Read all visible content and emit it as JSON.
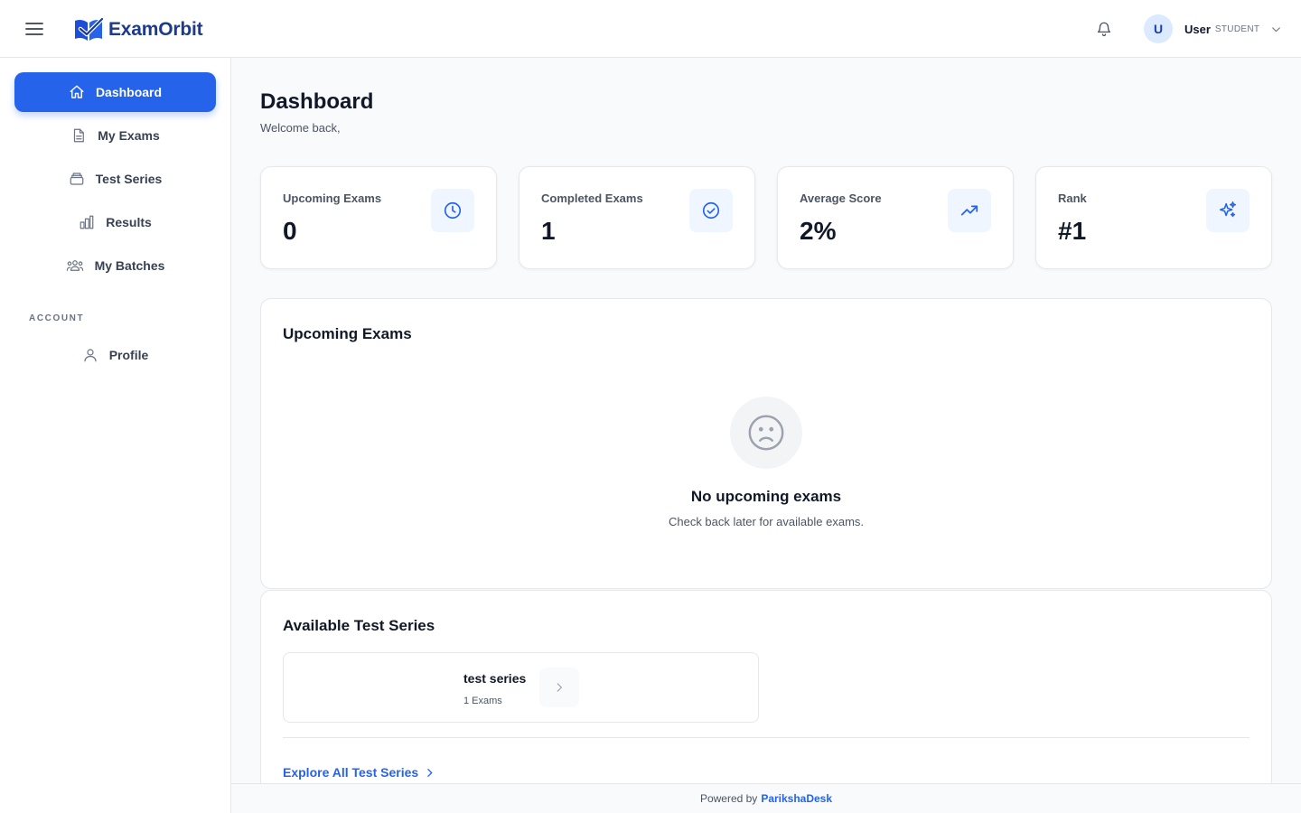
{
  "header": {
    "logo_text": "ExamOrbit",
    "user_initial": "U",
    "user_name": "User",
    "user_role": "STUDENT"
  },
  "sidebar": {
    "items": [
      {
        "label": "Dashboard",
        "icon": "home-icon",
        "active": true
      },
      {
        "label": "My Exams",
        "icon": "document-icon"
      },
      {
        "label": "Test Series",
        "icon": "stack-icon"
      },
      {
        "label": "Results",
        "icon": "bar-chart-icon"
      },
      {
        "label": "My Batches",
        "icon": "users-icon"
      }
    ],
    "section_account": "ACCOUNT",
    "account_items": [
      {
        "label": "Profile",
        "icon": "user-icon"
      }
    ]
  },
  "main": {
    "title": "Dashboard",
    "subtitle": "Welcome back,",
    "stats": [
      {
        "label": "Upcoming Exams",
        "value": "0",
        "icon": "clock-icon"
      },
      {
        "label": "Completed Exams",
        "value": "1",
        "icon": "check-circle-icon"
      },
      {
        "label": "Average Score",
        "value": "2%",
        "icon": "trending-up-icon"
      },
      {
        "label": "Rank",
        "value": "#1",
        "icon": "sparkles-icon"
      }
    ],
    "upcoming": {
      "title": "Upcoming Exams",
      "empty_title": "No upcoming exams",
      "empty_sub": "Check back later for available exams."
    },
    "series": {
      "title": "Available Test Series",
      "items": [
        {
          "name": "test series",
          "count": "1 Exams"
        }
      ],
      "explore_label": "Explore All Test Series"
    }
  },
  "footer": {
    "prefix": "Powered by",
    "brand": "ParikshaDesk"
  },
  "colors": {
    "primary": "#2563eb",
    "brand_dark": "#1e3a8a",
    "icon_bg": "#eff6ff",
    "background": "#f8fafc"
  }
}
